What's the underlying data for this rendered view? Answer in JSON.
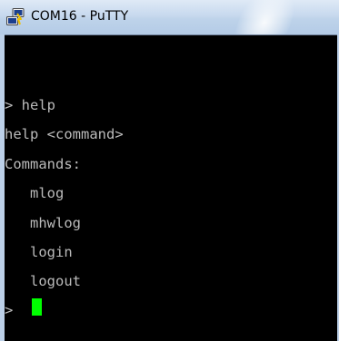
{
  "window": {
    "title": "COM16 - PuTTY",
    "icon": "putty-icon"
  },
  "terminal": {
    "lines": [
      "> help",
      "help <command>",
      "Commands:",
      "   mlog",
      "   mhwlog",
      "   login",
      "   logout",
      "> "
    ],
    "text_color": "#bbbbbb",
    "background": "#000000",
    "cursor_color": "#00ff00"
  }
}
